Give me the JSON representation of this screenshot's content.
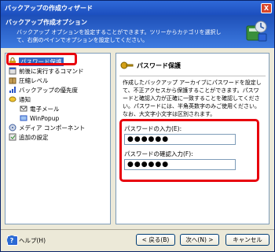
{
  "window": {
    "title": "バックアップの作成ウィザード",
    "help_glyph": "?",
    "close_glyph": "X"
  },
  "header": {
    "title": "バックアップ作成オプション",
    "description": "バックアップ オプションを設定することができます。ツリーからカテゴリを選択して、右側のペインでオプションを設定してください。"
  },
  "tree": {
    "items": [
      {
        "label": "パスワード保護",
        "icon": "lock-icon",
        "selected": true
      },
      {
        "label": "前後に実行するコマンド",
        "icon": "command-icon"
      },
      {
        "label": "圧縮レベル",
        "icon": "compression-icon"
      },
      {
        "label": "バックアップの優先度",
        "icon": "priority-icon"
      },
      {
        "label": "通知",
        "icon": "notification-icon"
      },
      {
        "label": "電子メール",
        "icon": "email-icon"
      },
      {
        "label": "WinPopup",
        "icon": "winpopup-icon"
      },
      {
        "label": "メディア コンポーネント",
        "icon": "media-icon"
      },
      {
        "label": "追加の設定",
        "icon": "settings-icon"
      }
    ]
  },
  "panel": {
    "title": "パスワード保護",
    "description": "作成したバックアップ アーカイブにパスワードを設定して、不正アクセスから保護することができます。パスワードと確認入力が正確に一致することを確認してください。パスワードには、半角英数字のみご使用ください。なお、大文字小文字は区別されます。",
    "password_label": "パスワードの入力(E):",
    "password_value": "●●●●●●",
    "confirm_label": "パスワードの確認入力(F):",
    "confirm_value": "●●●●●●"
  },
  "footer": {
    "help_label": "ヘルプ(H)",
    "back_label": "< 戻る(B)",
    "next_label": "次へ(N) >",
    "cancel_label": "キャンセル"
  },
  "colors": {
    "highlight": "#e8000c",
    "header_top": "#1e4fb8",
    "selection": "#316ac5"
  }
}
